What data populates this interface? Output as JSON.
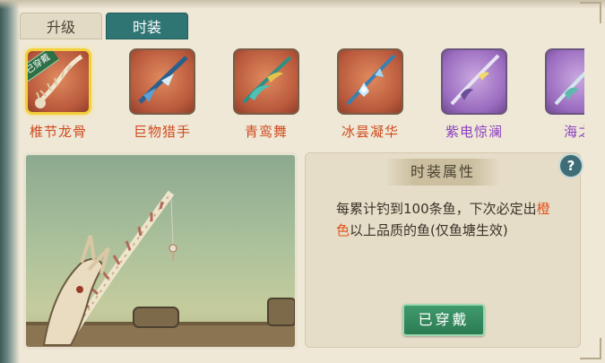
{
  "tabs": [
    {
      "label": "升级",
      "active": false
    },
    {
      "label": "时装",
      "active": true
    }
  ],
  "items": [
    {
      "name": "椎节龙骨",
      "rarity": "orange",
      "equipped": true,
      "badge": "已穿戴"
    },
    {
      "name": "巨物猎手",
      "rarity": "orange",
      "equipped": false
    },
    {
      "name": "青鸾舞",
      "rarity": "orange",
      "equipped": false
    },
    {
      "name": "冰昙凝华",
      "rarity": "orange",
      "equipped": false
    },
    {
      "name": "紫电惊澜",
      "rarity": "purple",
      "equipped": false
    },
    {
      "name": "海之",
      "rarity": "purple",
      "equipped": false
    }
  ],
  "attributes": {
    "title": "时装属性",
    "help_icon": "question-icon",
    "desc_part1": "每累计钓到100条鱼，下次必定出",
    "desc_highlight": "橙色",
    "desc_part2": "以上品质的鱼(仅鱼塘生效)",
    "equip_label": "已穿戴"
  },
  "colors": {
    "accent_tab": "#2f7574",
    "orange_rarity": "#cf4b1f",
    "purple_rarity": "#8b3fc0",
    "highlight": "#e0531c",
    "equip_button": "#2c7b52"
  }
}
